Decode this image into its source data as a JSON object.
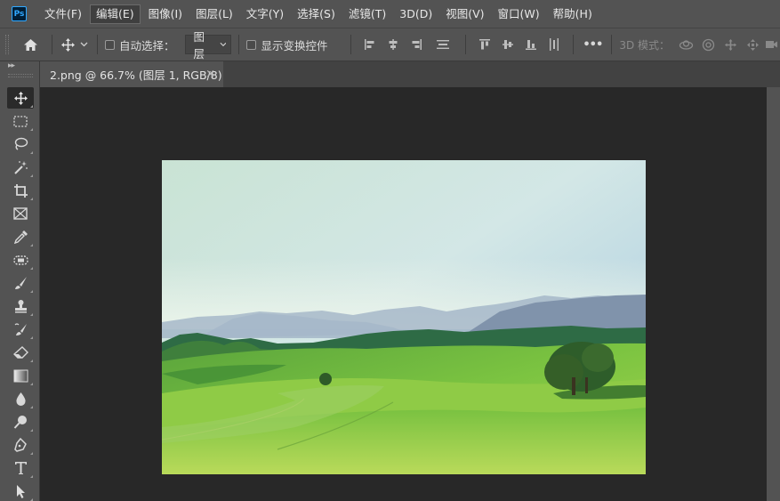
{
  "app": {
    "logo_text": "Ps"
  },
  "menu": [
    {
      "label": "文件(F)",
      "active": false
    },
    {
      "label": "编辑(E)",
      "active": true
    },
    {
      "label": "图像(I)",
      "active": false
    },
    {
      "label": "图层(L)",
      "active": false
    },
    {
      "label": "文字(Y)",
      "active": false
    },
    {
      "label": "选择(S)",
      "active": false
    },
    {
      "label": "滤镜(T)",
      "active": false
    },
    {
      "label": "3D(D)",
      "active": false
    },
    {
      "label": "视图(V)",
      "active": false
    },
    {
      "label": "窗口(W)",
      "active": false
    },
    {
      "label": "帮助(H)",
      "active": false
    }
  ],
  "options": {
    "auto_select_label": "自动选择：",
    "auto_select_checked": false,
    "layer_dropdown_value": "图层",
    "show_transform_label": "显示变换控件",
    "show_transform_checked": false,
    "more_label": "•••",
    "mode_3d_label": "3D 模式："
  },
  "document": {
    "tab_title": "2.png @ 66.7% (图层 1, RGB/8)",
    "close_glyph": "×"
  },
  "tools": [
    "move-tool",
    "marquee-tool",
    "lasso-tool",
    "magic-wand-tool",
    "crop-tool",
    "frame-tool",
    "eyedropper-tool",
    "healing-brush-tool",
    "brush-tool",
    "clone-stamp-tool",
    "history-brush-tool",
    "eraser-tool",
    "gradient-tool",
    "blur-tool",
    "dodge-tool",
    "pen-tool",
    "type-tool",
    "path-selection-tool"
  ],
  "colors": {
    "menubar_bg": "#535353",
    "workspace_bg": "#282828",
    "ps_blue": "#31a8ff"
  }
}
